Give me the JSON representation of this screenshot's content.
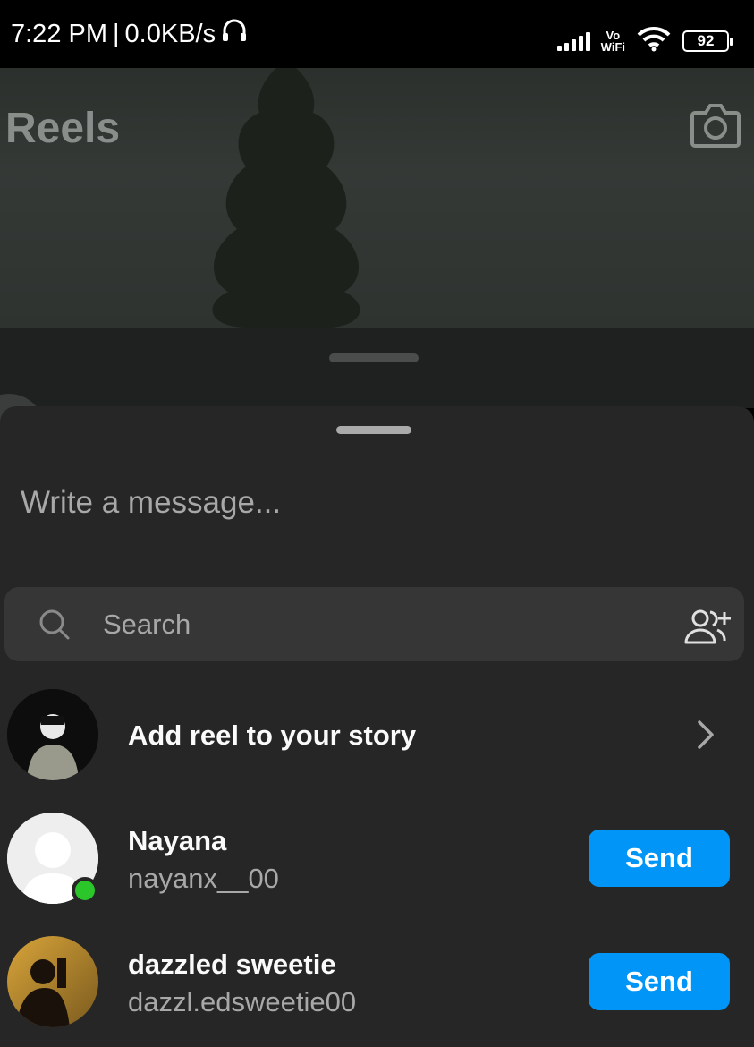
{
  "status_bar": {
    "time": "7:22 PM",
    "separator": "|",
    "network_speed": "0.0KB/s",
    "vowifi_top": "Vo",
    "vowifi_bottom": "WiFi",
    "battery": "92"
  },
  "background": {
    "title": "Reels"
  },
  "sheet": {
    "message_placeholder": "Write a message...",
    "search_placeholder": "Search",
    "story_row": {
      "label": "Add reel to your story"
    },
    "contacts": [
      {
        "name": "Nayana",
        "username": "nayanx__00",
        "online": true,
        "send_label": "Send"
      },
      {
        "name": "dazzled sweetie",
        "username": "dazzl.edsweetie00",
        "online": false,
        "send_label": "Send"
      }
    ]
  },
  "colors": {
    "accent": "#0095f6",
    "sheet_bg": "#262626",
    "online": "#2ac62a"
  }
}
